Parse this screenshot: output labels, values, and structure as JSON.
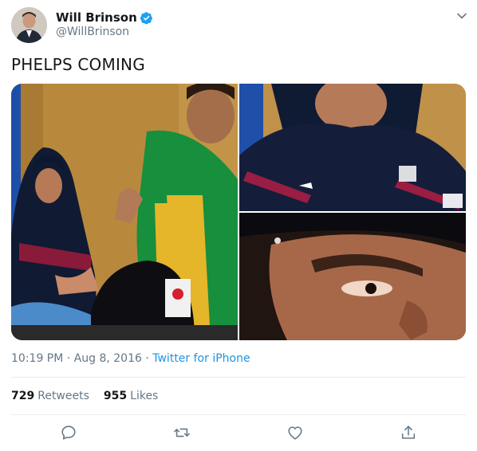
{
  "user": {
    "name": "Will Brinson",
    "handle": "@WillBrinson",
    "verified": true
  },
  "tweet": {
    "text": "PHELPS COMING",
    "time": "10:19 PM · Aug 8, 2016 · ",
    "source": "Twitter for iPhone"
  },
  "stats": {
    "retweets_count": "729",
    "retweets_label": "Retweets",
    "likes_count": "955",
    "likes_label": "Likes"
  },
  "actions": [
    "reply-icon",
    "retweet-icon",
    "like-icon",
    "share-icon"
  ],
  "colors": {
    "link": "#1b95e0",
    "secondary_text": "#657786",
    "verified": "#1da1f2",
    "divider": "#e6ecf0"
  }
}
